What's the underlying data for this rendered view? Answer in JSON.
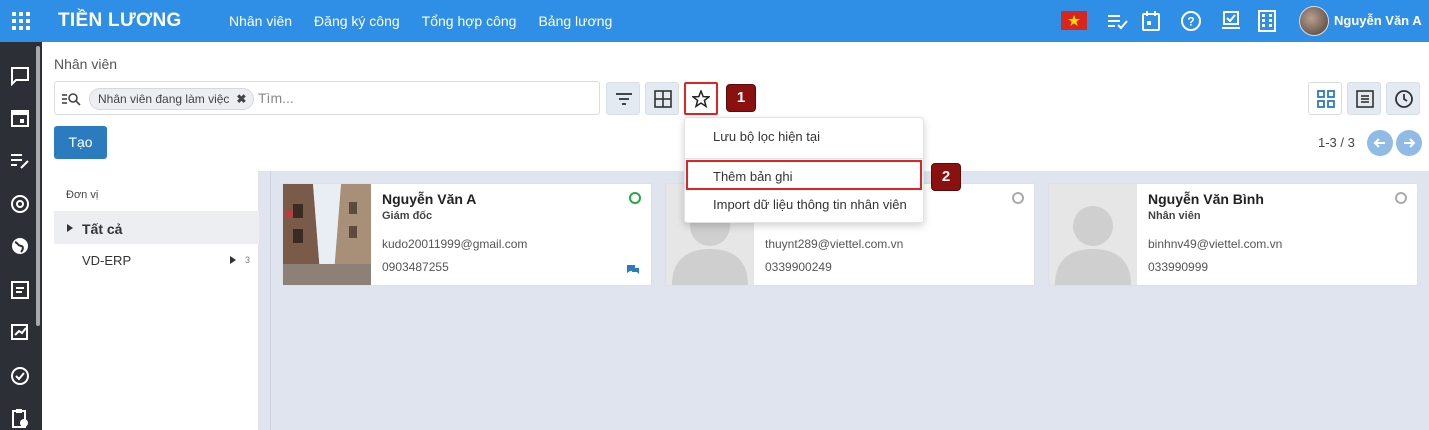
{
  "app": {
    "title": "TIỀN LƯƠNG"
  },
  "topnav": [
    "Nhân viên",
    "Đăng ký công",
    "Tổng hợp công",
    "Bảng lương"
  ],
  "user": {
    "name": "Nguyễn Văn A"
  },
  "breadcrumb": "Nhân viên",
  "search": {
    "facet": "Nhân viên đang làm việc",
    "placeholder": "Tìm..."
  },
  "actions": {
    "create": "Tạo"
  },
  "pager": "1-3 / 3",
  "dropdown": {
    "items": [
      "Lưu bộ lọc hiện tại",
      "Thêm bản ghi",
      "Import dữ liệu thông tin nhân viên"
    ]
  },
  "annotations": [
    "1",
    "2"
  ],
  "org": {
    "heading": "Đơn vị",
    "all": "Tất cả",
    "units": [
      {
        "name": "VD-ERP",
        "count": "3"
      }
    ]
  },
  "employees": [
    {
      "name": "Nguyễn Văn A",
      "job": "Giám đốc",
      "email": "kudo20011999@gmail.com",
      "phone": "0903487255",
      "online": true
    },
    {
      "name": "",
      "job": "",
      "email": "thuynt289@viettel.com.vn",
      "phone": "0339900249",
      "online": false
    },
    {
      "name": "Nguyễn Văn Bình",
      "job": "Nhân viên",
      "email": "binhnv49@viettel.com.vn",
      "phone": "033990999",
      "online": false
    }
  ],
  "colors": {
    "topbar": "#2f8fe6",
    "sidebar": "#2c3036",
    "primary": "#2b7bbf",
    "highlight": "#e02323",
    "badge": "#8b1010"
  },
  "icons": [
    "apps-grid-icon",
    "flag-vn-icon",
    "activity-icon",
    "calendar-icon",
    "help-icon",
    "checklist-icon",
    "building-icon",
    "filter-icon",
    "group-by-icon",
    "star-icon",
    "kanban-icon",
    "list-icon",
    "activity-view-icon",
    "arrow-left-icon",
    "arrow-right-icon",
    "chat-icon"
  ]
}
